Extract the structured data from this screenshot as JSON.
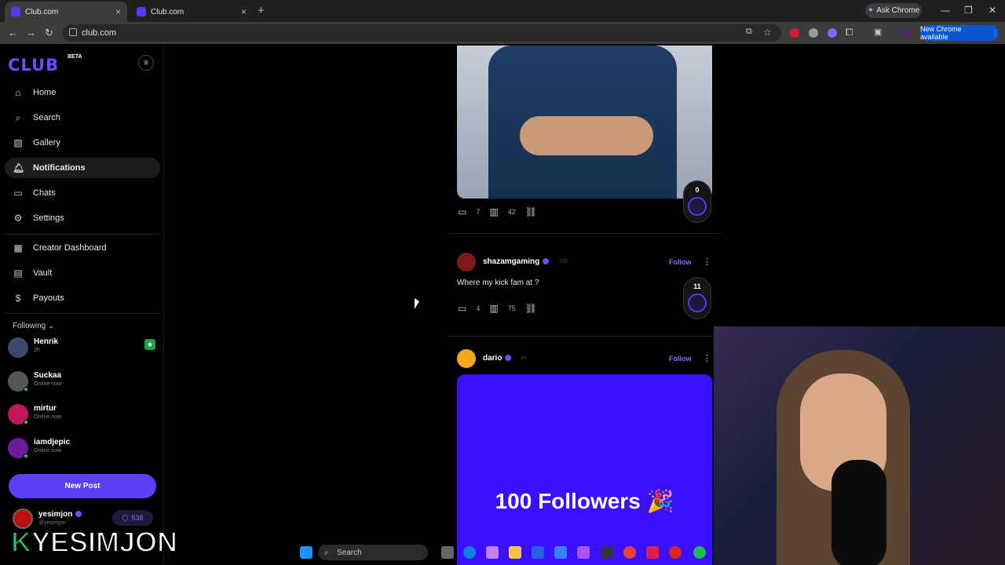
{
  "browser": {
    "tabs": [
      {
        "label": "Club.com",
        "active": true
      },
      {
        "label": "Club.com",
        "active": false
      }
    ],
    "ask_chrome": "Ask Chrome",
    "url": "club.com",
    "new_chrome": "New Chrome available"
  },
  "sidebar": {
    "logo": "CLUB",
    "beta": "BETA",
    "nav": [
      {
        "label": "Home",
        "icon": "home-icon"
      },
      {
        "label": "Search",
        "icon": "search-icon"
      },
      {
        "label": "Gallery",
        "icon": "gallery-icon"
      },
      {
        "label": "Notifications",
        "icon": "bell-icon",
        "active": true
      },
      {
        "label": "Chats",
        "icon": "chat-icon"
      },
      {
        "label": "Settings",
        "icon": "gear-icon"
      }
    ],
    "nav2": [
      {
        "label": "Creator Dashboard",
        "icon": "dashboard-icon"
      },
      {
        "label": "Vault",
        "icon": "vault-icon"
      },
      {
        "label": "Payouts",
        "icon": "dollar-icon"
      }
    ],
    "following_label": "Following",
    "following": [
      {
        "name": "Henrik",
        "status": "2h"
      },
      {
        "name": "Suckaa",
        "status": "Online now"
      },
      {
        "name": "mirtur",
        "status": "Online now"
      },
      {
        "name": "iamdjepic",
        "status": "Online now"
      }
    ],
    "new_post": "New Post",
    "me": {
      "name": "yesimjon",
      "handle": "@yesimjon",
      "points": "538"
    }
  },
  "feed": {
    "post1": {
      "comments": "7",
      "views": "42",
      "coin": "0"
    },
    "post2": {
      "author": "shazamgaming",
      "time": "16h",
      "follow": "Follow",
      "text": "Where my kick fam at ?",
      "comments": "4",
      "views": "75",
      "coin": "11"
    },
    "post3": {
      "author": "dario",
      "time": "4h",
      "follow": "Follow",
      "banner": "100 Followers 🎉"
    }
  },
  "overlay": {
    "watermark": "YESIMJON",
    "watermark_k": "K"
  },
  "taskbar": {
    "search": "Search"
  },
  "colors": {
    "accent": "#5b3ef5",
    "background": "#000000"
  }
}
